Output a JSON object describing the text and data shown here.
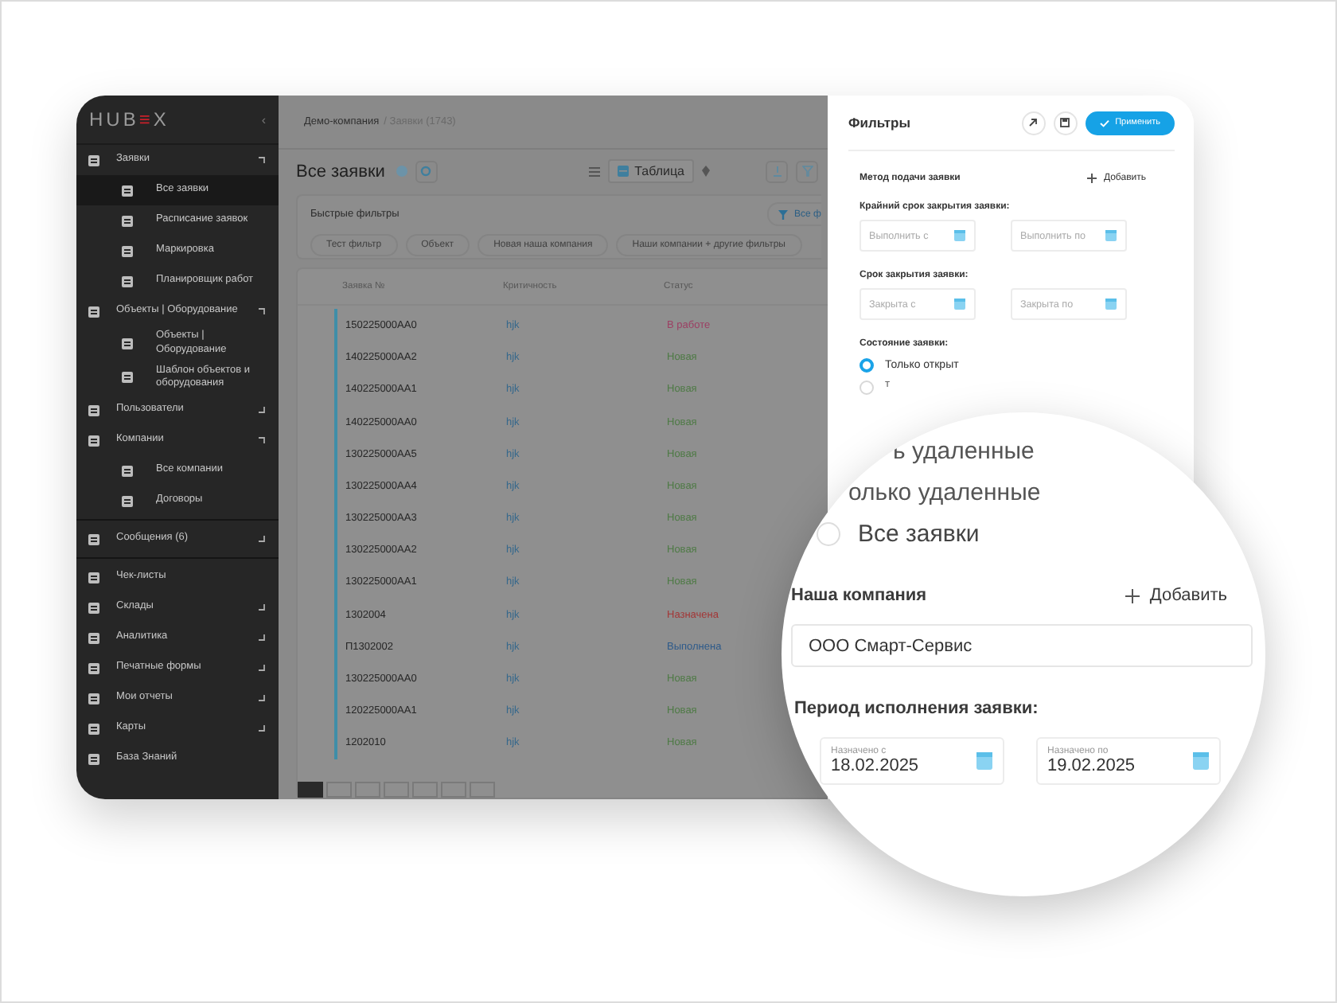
{
  "logo": {
    "parts": [
      "HUB",
      "≡",
      "X"
    ],
    "collapse": "‹"
  },
  "sidebar": {
    "sections": [
      [
        {
          "label": "Заявки",
          "selected": false,
          "expanded": true,
          "children": [
            {
              "label": "Все заявки",
              "selected": true
            },
            {
              "label": "Расписание заявок",
              "selected": false
            },
            {
              "label": "Маркировка",
              "selected": false
            },
            {
              "label": "Планировщик работ",
              "selected": false
            }
          ]
        },
        {
          "label": "Объекты | Оборудование",
          "selected": false,
          "expanded": true,
          "children": [
            {
              "label": "Объекты | Оборудование",
              "selected": false
            },
            {
              "label": "Шаблон объектов и оборудования",
              "selected": false
            }
          ]
        },
        {
          "label": "Пользователи",
          "selected": false,
          "expanded": false
        },
        {
          "label": "Компании",
          "selected": false,
          "expanded": true,
          "children": [
            {
              "label": "Все компании",
              "selected": false
            },
            {
              "label": "Договоры",
              "selected": false
            }
          ]
        }
      ],
      [
        {
          "label": "Сообщения (6)",
          "selected": false,
          "expanded": false
        }
      ],
      [
        {
          "label": "Чек-листы",
          "selected": false
        },
        {
          "label": "Склады",
          "selected": false,
          "expanded": false
        },
        {
          "label": "Аналитика",
          "selected": false,
          "expanded": false
        },
        {
          "label": "Печатные формы",
          "selected": false,
          "expanded": false
        },
        {
          "label": "Мои отчеты",
          "selected": false,
          "expanded": false
        },
        {
          "label": "Карты",
          "selected": false,
          "expanded": false
        },
        {
          "label": "База Знаний",
          "selected": false
        }
      ]
    ]
  },
  "breadcrumb": [
    {
      "text": "Демо-компания",
      "current": false
    },
    {
      "text": "/ Заявки (1743)",
      "current": true
    }
  ],
  "header": {
    "title": "Все заявки",
    "view": "Таблица"
  },
  "quick_filters": {
    "title": "Быстрые фильтры",
    "all_button": "Все ф",
    "chips": [
      "Тест фильтр",
      "Объект",
      "Новая наша компания",
      "Наши компании + другие фильтры"
    ]
  },
  "table": {
    "columns": [
      "Заявка №",
      "Критичность",
      "Статус"
    ],
    "rows": [
      {
        "number": "150225000AA0",
        "criticality": "hjk",
        "status": "В работе",
        "color": "#9c3f63"
      },
      {
        "number": "140225000AA2",
        "criticality": "hjk",
        "status": "Новая",
        "color": "#4d7a44"
      },
      {
        "number": "140225000AA1",
        "criticality": "hjk",
        "status": "Новая",
        "color": "#4d7a44"
      },
      {
        "number": "140225000AA0",
        "criticality": "hjk",
        "status": "Новая",
        "color": "#4d7a44"
      },
      {
        "number": "130225000AA5",
        "criticality": "hjk",
        "status": "Новая",
        "color": "#4d7a44"
      },
      {
        "number": "130225000AA4",
        "criticality": "hjk",
        "status": "Новая",
        "color": "#4d7a44"
      },
      {
        "number": "130225000AA3",
        "criticality": "hjk",
        "status": "Новая",
        "color": "#4d7a44"
      },
      {
        "number": "130225000AA2",
        "criticality": "hjk",
        "status": "Новая",
        "color": "#4d7a44"
      },
      {
        "number": "130225000AA1",
        "criticality": "hjk",
        "status": "Новая",
        "color": "#4d7a44"
      },
      {
        "number": "1302004",
        "criticality": "hjk",
        "status": "Назначена",
        "color": "#a33636"
      },
      {
        "number": "П1302002",
        "criticality": "hjk",
        "status": "Выполнена",
        "color": "#2d5a8a"
      },
      {
        "number": "130225000AA0",
        "criticality": "hjk",
        "status": "Новая",
        "color": "#4d7a44"
      },
      {
        "number": "120225000AA1",
        "criticality": "hjk",
        "status": "Новая",
        "color": "#4d7a44"
      },
      {
        "number": "1202010",
        "criticality": "hjk",
        "status": "Новая",
        "color": "#4d7a44"
      }
    ]
  },
  "pagination": [
    {
      "selected": true
    },
    {
      "selected": false
    },
    {
      "selected": false
    },
    {
      "selected": false
    },
    {
      "selected": false
    },
    {
      "selected": false
    },
    {
      "selected": false
    }
  ],
  "filters": {
    "title": "Фильтры",
    "apply": "Применить",
    "sections": [
      {
        "kind": "add",
        "label": "Метод подачи заявки",
        "add": "Добавить"
      },
      {
        "kind": "range",
        "label": "Крайний срок закрытия заявки:",
        "from": {
          "placeholder": "Выполнить с"
        },
        "to": {
          "placeholder": "Выполнить по"
        }
      },
      {
        "kind": "range",
        "label": "Срок закрытия заявки:",
        "from": {
          "placeholder": "Закрыта с"
        },
        "to": {
          "placeholder": "Закрыта по"
        }
      },
      {
        "kind": "radio",
        "label": "Состояние заявки:",
        "options": [
          {
            "label": "Только открыт",
            "selected": true
          },
          {
            "label": "Т",
            "selected": false
          }
        ]
      }
    ]
  },
  "magnifier": {
    "fragments": [
      "ь удаленные",
      "олько удаленные"
    ],
    "radio": {
      "label": "Все заявки",
      "selected": false
    },
    "company": {
      "label": "Наша компания",
      "add": "Добавить",
      "value": "ООО Смарт-Сервис"
    },
    "period": {
      "label": "Период исполнения заявки:",
      "from": {
        "label": "Назначено с",
        "value": "18.02.2025"
      },
      "to": {
        "label": "Назначено по",
        "value": "19.02.2025"
      }
    }
  }
}
